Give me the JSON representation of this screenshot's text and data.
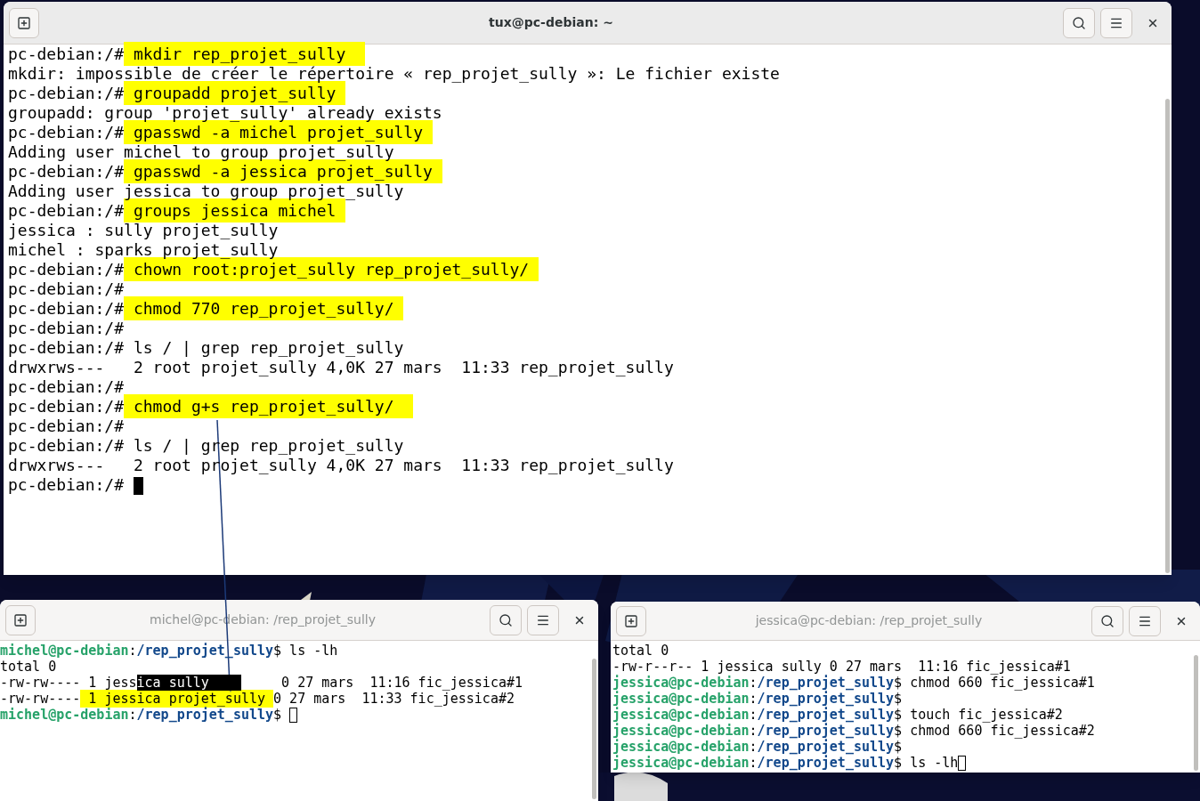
{
  "windows": [
    {
      "title": "tux@pc-debian: ~",
      "focused": true,
      "kind": "large",
      "lines": [
        [
          {
            "kind": "plain",
            "text": "pc-debian:/#"
          },
          {
            "kind": "highlight",
            "text": " mkdir rep_projet_sully  "
          }
        ],
        [
          {
            "kind": "plain",
            "text": "mkdir: impossible de créer le répertoire « rep_projet_sully »: Le fichier existe"
          }
        ],
        [
          {
            "kind": "plain",
            "text": "pc-debian:/#"
          },
          {
            "kind": "highlight",
            "text": " groupadd projet_sully "
          }
        ],
        [
          {
            "kind": "plain",
            "text": "groupadd: group 'projet_sully' already exists"
          }
        ],
        [
          {
            "kind": "plain",
            "text": "pc-debian:/#"
          },
          {
            "kind": "highlight",
            "text": " gpasswd -a michel projet_sully "
          }
        ],
        [
          {
            "kind": "plain",
            "text": "Adding user michel to group projet_sully"
          }
        ],
        [
          {
            "kind": "plain",
            "text": "pc-debian:/#"
          },
          {
            "kind": "highlight",
            "text": " gpasswd -a jessica projet_sully "
          }
        ],
        [
          {
            "kind": "plain",
            "text": "Adding user jessica to group projet_sully"
          }
        ],
        [
          {
            "kind": "plain",
            "text": "pc-debian:/#"
          },
          {
            "kind": "highlight",
            "text": " groups jessica michel "
          }
        ],
        [
          {
            "kind": "plain",
            "text": "jessica : sully projet_sully"
          }
        ],
        [
          {
            "kind": "plain",
            "text": "michel : sparks projet_sully"
          }
        ],
        [
          {
            "kind": "plain",
            "text": "pc-debian:/#"
          },
          {
            "kind": "highlight",
            "text": " chown root:projet_sully rep_projet_sully/ "
          }
        ],
        [
          {
            "kind": "plain",
            "text": "pc-debian:/#"
          }
        ],
        [
          {
            "kind": "plain",
            "text": "pc-debian:/#"
          },
          {
            "kind": "highlight",
            "text": " chmod 770 rep_projet_sully/ "
          }
        ],
        [
          {
            "kind": "plain",
            "text": "pc-debian:/#"
          }
        ],
        [
          {
            "kind": "plain",
            "text": "pc-debian:/# ls / | grep rep_projet_sully"
          }
        ],
        [
          {
            "kind": "plain",
            "text": "drwxrws---   2 root projet_sully 4,0K 27 mars  11:33 rep_projet_sully"
          }
        ],
        [
          {
            "kind": "plain",
            "text": "pc-debian:/#"
          }
        ],
        [
          {
            "kind": "plain",
            "text": "pc-debian:/#"
          },
          {
            "kind": "highlight",
            "text": " chmod g+s rep_projet_sully/  "
          }
        ],
        [
          {
            "kind": "plain",
            "text": "pc-debian:/#"
          }
        ],
        [
          {
            "kind": "plain",
            "text": "pc-debian:/# ls / | grep rep_projet_sully"
          }
        ],
        [
          {
            "kind": "plain",
            "text": "drwxrws---   2 root projet_sully 4,0K 27 mars  11:33 rep_projet_sully"
          }
        ],
        [
          {
            "kind": "plain",
            "text": "pc-debian:/# "
          }
        ]
      ]
    },
    {
      "title": "michel@pc-debian: /rep_projet_sully",
      "focused": false,
      "kind": "left",
      "lines": [
        [
          {
            "kind": "user",
            "text": "michel@pc-debian"
          },
          {
            "kind": "plain",
            "text": ":"
          },
          {
            "kind": "path",
            "text": "/rep_projet_sully"
          },
          {
            "kind": "plain",
            "text": "$ ls -lh"
          }
        ],
        [
          {
            "kind": "plain",
            "text": "total 0"
          }
        ],
        [
          {
            "kind": "plain",
            "text": "-rw-rw---- 1 jess"
          },
          {
            "kind": "selection",
            "text": "ica sully    "
          },
          {
            "kind": "plain",
            "text": "     0 27 mars  11:16 fic_jessica#1"
          }
        ],
        [
          {
            "kind": "plain",
            "text": "-rw-rw----"
          },
          {
            "kind": "highlight",
            "text": " 1 jessica projet_sully "
          },
          {
            "kind": "plain",
            "text": "0 27 mars  11:33 fic_jessica#2"
          }
        ],
        [
          {
            "kind": "user",
            "text": "michel@pc-debian"
          },
          {
            "kind": "plain",
            "text": ":"
          },
          {
            "kind": "path",
            "text": "/rep_projet_sully"
          },
          {
            "kind": "plain",
            "text": "$ "
          }
        ]
      ]
    },
    {
      "title": "jessica@pc-debian: /rep_projet_sully",
      "focused": false,
      "kind": "right",
      "lines": [
        [
          {
            "kind": "plain",
            "text": "total 0"
          }
        ],
        [
          {
            "kind": "plain",
            "text": "-rw-r--r-- 1 jessica sully 0 27 mars  11:16 fic_jessica#1"
          }
        ],
        [
          {
            "kind": "user",
            "text": "jessica@pc-debian"
          },
          {
            "kind": "plain",
            "text": ":"
          },
          {
            "kind": "path",
            "text": "/rep_projet_sully"
          },
          {
            "kind": "plain",
            "text": "$ chmod 660 fic_jessica#1"
          }
        ],
        [
          {
            "kind": "user",
            "text": "jessica@pc-debian"
          },
          {
            "kind": "plain",
            "text": ":"
          },
          {
            "kind": "path",
            "text": "/rep_projet_sully"
          },
          {
            "kind": "plain",
            "text": "$"
          }
        ],
        [
          {
            "kind": "user",
            "text": "jessica@pc-debian"
          },
          {
            "kind": "plain",
            "text": ":"
          },
          {
            "kind": "path",
            "text": "/rep_projet_sully"
          },
          {
            "kind": "plain",
            "text": "$ touch fic_jessica#2"
          }
        ],
        [
          {
            "kind": "user",
            "text": "jessica@pc-debian"
          },
          {
            "kind": "plain",
            "text": ":"
          },
          {
            "kind": "path",
            "text": "/rep_projet_sully"
          },
          {
            "kind": "plain",
            "text": "$ chmod 660 fic_jessica#2"
          }
        ],
        [
          {
            "kind": "user",
            "text": "jessica@pc-debian"
          },
          {
            "kind": "plain",
            "text": ":"
          },
          {
            "kind": "path",
            "text": "/rep_projet_sully"
          },
          {
            "kind": "plain",
            "text": "$"
          }
        ],
        [
          {
            "kind": "user",
            "text": "jessica@pc-debian"
          },
          {
            "kind": "plain",
            "text": ":"
          },
          {
            "kind": "path",
            "text": "/rep_projet_sully"
          },
          {
            "kind": "plain",
            "text": "$ ls -lh"
          }
        ]
      ]
    }
  ]
}
